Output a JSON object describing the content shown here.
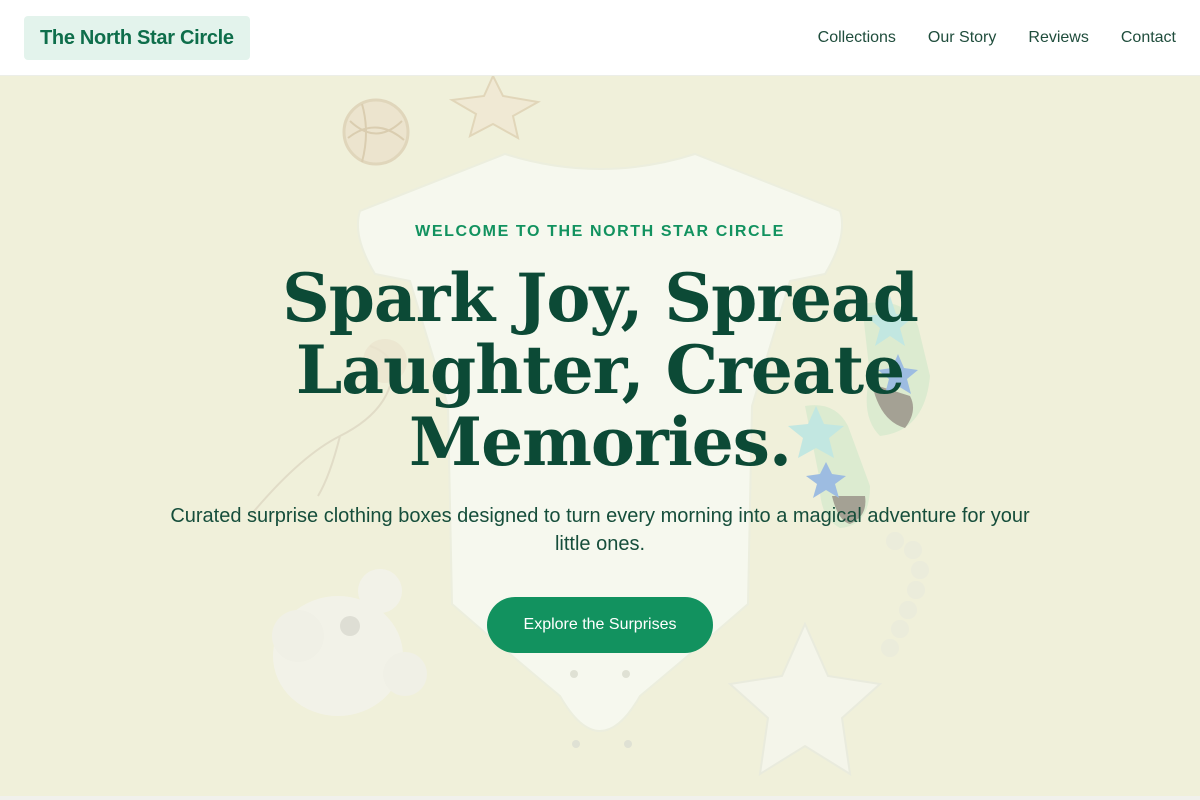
{
  "header": {
    "brand": "The North Star Circle",
    "nav": [
      {
        "label": "Collections"
      },
      {
        "label": "Our Story"
      },
      {
        "label": "Reviews"
      },
      {
        "label": "Contact"
      }
    ]
  },
  "hero": {
    "eyebrow": "WELCOME TO THE NORTH STAR CIRCLE",
    "headline": "Spark Joy, Spread Laughter, Create Memories.",
    "subhead": "Curated surprise clothing boxes designed to turn every morning into a magical adventure for your little ones.",
    "cta_label": "Explore the Surprises"
  },
  "colors": {
    "brand_green": "#12925f",
    "dark_green": "#0c4a36",
    "hero_bg": "#eeeed6",
    "brand_bg": "#e3f3ec"
  }
}
